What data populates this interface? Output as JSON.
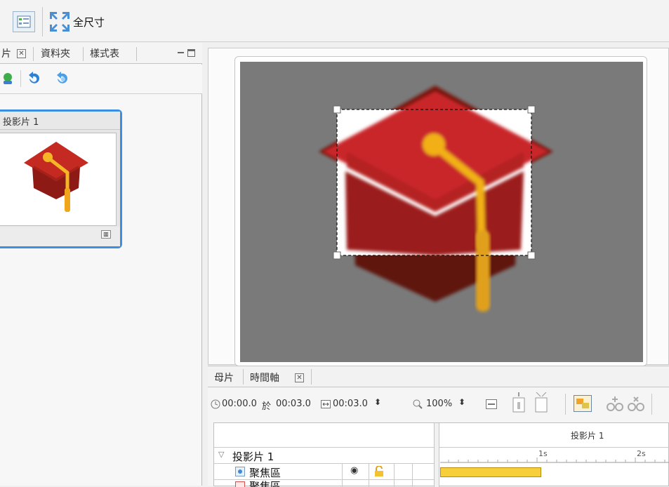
{
  "toolbar": {
    "fullsize_label": "全尺寸"
  },
  "left_panel": {
    "tabs": [
      "片",
      "資料夾",
      "樣式表"
    ],
    "slide_title": "投影片 1"
  },
  "timeline": {
    "tabs": [
      "母片",
      "時間軸"
    ],
    "time_current": "00:00.0",
    "time_connector": "於",
    "time_total": "00:03.0",
    "duration": "00:03.0",
    "zoom": "100%",
    "header_slide": "投影片 1",
    "tree_root": "投影片 1",
    "tree_child_1": "聚焦區",
    "tree_child_2": "聚焦區",
    "ruler_1": "1s",
    "ruler_2": "2s"
  },
  "colors": {
    "stage_bg": "#7a7a7a",
    "accent_blue": "#3c8ee0",
    "bar_yellow": "#f7cf3a",
    "cap_red": "#b0261e"
  }
}
